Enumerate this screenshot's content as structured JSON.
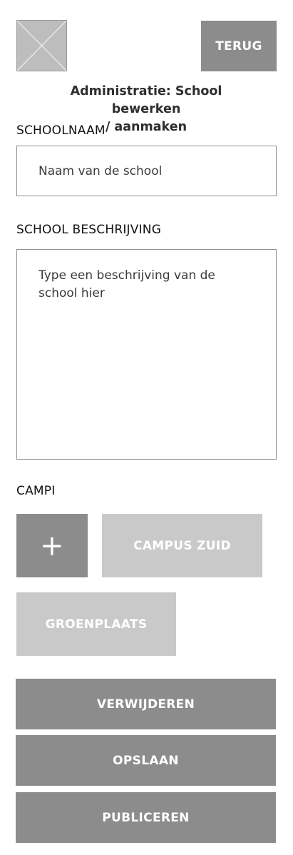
{
  "header": {
    "logo_icon": "image-placeholder-icon",
    "back_label": "TERUG",
    "title_line1": "Administratie: School bewerken",
    "title_line2": "/ aanmaken"
  },
  "form": {
    "school_name_label": "SCHOOLNAAM",
    "school_name_placeholder": "Naam van de school",
    "description_label": "SCHOOL BESCHRIJVING",
    "description_placeholder": "Type een beschrijving van de school hier"
  },
  "campi": {
    "label": "CAMPI",
    "add_symbol": "+",
    "items": [
      {
        "label": "CAMPUS ZUID"
      },
      {
        "label": "GROENPLAATS"
      }
    ]
  },
  "actions": {
    "delete_label": "VERWIJDEREN",
    "save_label": "OPSLAAN",
    "publish_label": "PUBLICEREN"
  },
  "colors": {
    "button_dark": "#8c8c8c",
    "button_light": "#c9c9c9",
    "border": "#8f8f8f",
    "placeholder_image": "#bdbdbd"
  }
}
